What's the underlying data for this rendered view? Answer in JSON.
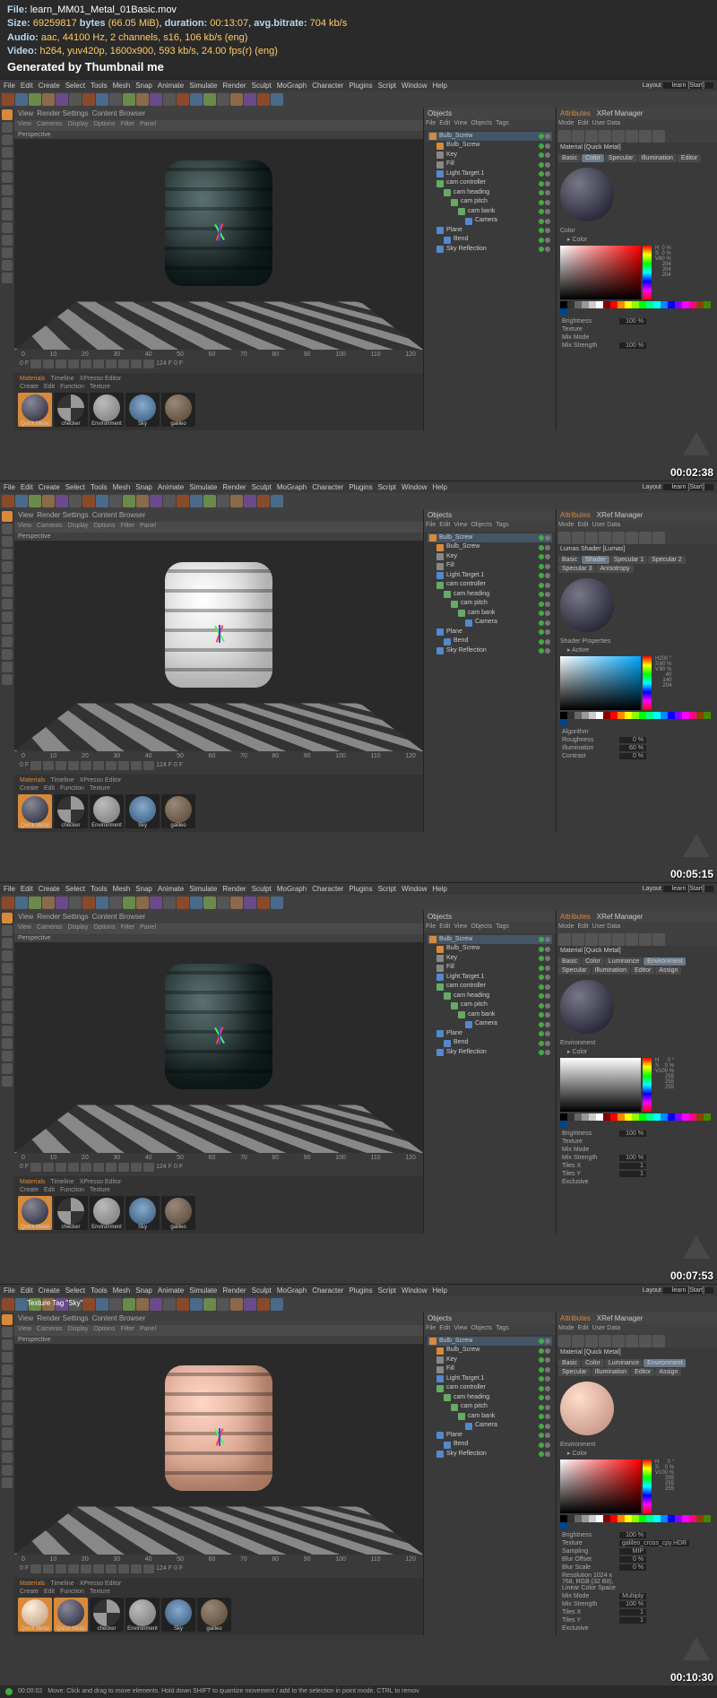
{
  "header": {
    "file_label": "File:",
    "file": "learn_MM01_Metal_01Basic.mov",
    "size_label": "Size:",
    "size_bytes": "69259817",
    "size_unit": "bytes",
    "size_mib": "(66.05 MiB)",
    "duration_label": "duration:",
    "duration": "00:13:07",
    "bitrate_label": "avg.bitrate:",
    "bitrate": "704 kb/s",
    "audio_label": "Audio:",
    "audio": "aac, 44100 Hz, 2 channels, s16, 106 kb/s (eng)",
    "video_label": "Video:",
    "video": "h264, yuv420p, 1600x900, 593 kb/s, 24.00 fps(r) (eng)",
    "generated": "Generated by Thumbnail me"
  },
  "menus": [
    "File",
    "Edit",
    "Create",
    "Select",
    "Tools",
    "Mesh",
    "Snap",
    "Animate",
    "Simulate",
    "Render",
    "Sculpt",
    "MoGraph",
    "Character",
    "Plugins",
    "Script",
    "Window",
    "Help"
  ],
  "layout_label": "Layout",
  "layout_value": "learn [Start]",
  "vp_header": [
    "View",
    "Render Settings",
    "Content Browser"
  ],
  "vp_sub": [
    "View",
    "Cameras",
    "Display",
    "Options",
    "Filter",
    "Panel"
  ],
  "vp_label": "Perspective",
  "timeline_ticks": [
    "0",
    "10",
    "20",
    "30",
    "40",
    "50",
    "60",
    "70",
    "80",
    "90",
    "100",
    "110",
    "120"
  ],
  "timeline_start": "0 F",
  "timeline_end": "124 F",
  "timeline_cur": "0 F",
  "materials_header": [
    "Create",
    "Edit",
    "Function",
    "Texture"
  ],
  "materials_tab1": "Materials",
  "materials_tab2": "Timeline",
  "materials_tab3": "XPresso Editor",
  "mat_names": [
    "Quick Metal",
    "checker",
    "Environment",
    "Sky",
    "galileo"
  ],
  "objects_title": "Objects",
  "objects_tabs": [
    "File",
    "Edit",
    "View",
    "Objects",
    "Tags"
  ],
  "tree": [
    {
      "name": "Bulb_Screw",
      "lvl": 0,
      "ic": "ti-orange",
      "sel": true
    },
    {
      "name": "Bulb_Screw",
      "lvl": 1,
      "ic": "ti-orange"
    },
    {
      "name": "Key",
      "lvl": 1,
      "ic": "ti-gray"
    },
    {
      "name": "Fill",
      "lvl": 1,
      "ic": "ti-gray"
    },
    {
      "name": "Light.Target.1",
      "lvl": 1,
      "ic": "ti-blue"
    },
    {
      "name": "cam controller",
      "lvl": 1,
      "ic": "ti-green"
    },
    {
      "name": "cam heading",
      "lvl": 2,
      "ic": "ti-green"
    },
    {
      "name": "cam pitch",
      "lvl": 3,
      "ic": "ti-green"
    },
    {
      "name": "cam bank",
      "lvl": 4,
      "ic": "ti-green"
    },
    {
      "name": "Camera",
      "lvl": 5,
      "ic": "ti-blue"
    },
    {
      "name": "Plane",
      "lvl": 1,
      "ic": "ti-blue"
    },
    {
      "name": "Bend",
      "lvl": 2,
      "ic": "ti-blue"
    },
    {
      "name": "Sky Reflection",
      "lvl": 1,
      "ic": "ti-blue"
    }
  ],
  "attr_title": "Attributes",
  "attr_tab2": "XRef Manager",
  "attr_sub": [
    "Mode",
    "Edit",
    "User Data"
  ],
  "frames": [
    {
      "ts": "00:02:38",
      "obj": "obj-dark",
      "mat_title": "Material [Quick Metal]",
      "tabs": [
        {
          "l": "Basic"
        },
        {
          "l": "Color",
          "a": true
        },
        {
          "l": "Specular"
        },
        {
          "l": "Illumination"
        },
        {
          "l": "Editor"
        }
      ],
      "sect": "Color",
      "sub": "Color",
      "picker": "red",
      "preview": "",
      "cvals": [
        [
          "H",
          "0 %"
        ],
        [
          "S",
          "0 %"
        ],
        [
          "V",
          "80 %"
        ],
        [
          "",
          "204"
        ],
        [
          "",
          "204"
        ],
        [
          "",
          "204"
        ]
      ],
      "params": [
        [
          "Brightness",
          "100 %"
        ],
        [
          "Texture",
          ""
        ],
        [
          "Mix Mode",
          ""
        ],
        [
          "Mix Strength",
          "100 %"
        ]
      ]
    },
    {
      "ts": "00:05:15",
      "obj": "obj-white",
      "mat_title": "Lumas Shader [Lumas]",
      "tabs": [
        {
          "l": "Basic"
        },
        {
          "l": "Shader",
          "a": true
        },
        {
          "l": "Specular 1"
        },
        {
          "l": "Specular 2"
        },
        {
          "l": "Specular 3"
        },
        {
          "l": "Anisotropy"
        }
      ],
      "sect": "Shader Properties",
      "sub": "Active",
      "picker": "blue",
      "preview": "",
      "cvals": [
        [
          "H",
          "200 °"
        ],
        [
          "S",
          "80 %"
        ],
        [
          "V",
          "80 %"
        ],
        [
          "",
          "40"
        ],
        [
          "",
          "140"
        ],
        [
          "",
          "204"
        ]
      ],
      "params": [
        [
          "Algorithm",
          ""
        ],
        [
          "Roughness",
          "0 %"
        ],
        [
          "Illumination",
          "60 %"
        ],
        [
          "Contrast",
          "0 %"
        ]
      ]
    },
    {
      "ts": "00:07:53",
      "obj": "obj-dark",
      "mat_title": "Material [Quick Metal]",
      "tabs": [
        {
          "l": "Basic"
        },
        {
          "l": "Color"
        },
        {
          "l": "Luminance"
        },
        {
          "l": "Environment",
          "a": true
        },
        {
          "l": "Specular"
        },
        {
          "l": "Illumination"
        },
        {
          "l": "Editor"
        },
        {
          "l": "Assign"
        }
      ],
      "sect": "Environment",
      "sub": "Color",
      "picker": "white",
      "preview": "",
      "cvals": [
        [
          "H",
          "0 °"
        ],
        [
          "S",
          "0 %"
        ],
        [
          "V",
          "100 %"
        ],
        [
          "",
          "255"
        ],
        [
          "",
          "255"
        ],
        [
          "",
          "255"
        ]
      ],
      "params": [
        [
          "Brightness",
          "100 %"
        ],
        [
          "Texture",
          ""
        ],
        [
          "Mix Mode",
          ""
        ],
        [
          "Mix Strength",
          "100 %"
        ],
        [
          "Tiles X",
          "1"
        ],
        [
          "Tiles Y",
          "1"
        ],
        [
          "Exclusive",
          ""
        ]
      ]
    },
    {
      "ts": "00:10:30",
      "obj": "obj-copper",
      "mat_title": "Material [Quick Metal]",
      "tabs": [
        {
          "l": "Basic"
        },
        {
          "l": "Color"
        },
        {
          "l": "Luminance"
        },
        {
          "l": "Environment",
          "a": true
        },
        {
          "l": "Specular"
        },
        {
          "l": "Illumination"
        },
        {
          "l": "Editor"
        },
        {
          "l": "Assign"
        }
      ],
      "sect": "Environment",
      "sub": "Color",
      "picker": "red",
      "preview": "copper",
      "cvals": [
        [
          "H",
          "0 °"
        ],
        [
          "S",
          "0 %"
        ],
        [
          "V",
          "100 %"
        ],
        [
          "",
          "255"
        ],
        [
          "",
          "255"
        ],
        [
          "",
          "255"
        ]
      ],
      "params": [
        [
          "Brightness",
          "100 %"
        ],
        [
          "Texture",
          "galileo_cross_cpy.HDR"
        ],
        [
          "Sampling",
          "MIP"
        ],
        [
          "Blur Offset",
          "0 %"
        ],
        [
          "Blur Scale",
          "0 %"
        ],
        [
          "Resolution 1024 x 768, RGB (32 Bit), Linear Color Space",
          ""
        ],
        [
          "Mix Mode",
          "Multiply"
        ],
        [
          "Mix Strength",
          "100 %"
        ],
        [
          "Tiles X",
          "1"
        ],
        [
          "Tiles Y",
          "1"
        ],
        [
          "Exclusive",
          ""
        ]
      ],
      "title_prefix": "Texture Tag \"Sky\""
    }
  ],
  "status": {
    "time": "00:00:02",
    "hint": "Move: Click and drag to move elements. Hold down SHIFT to quantize movement / add to the selection in point mode, CTRL to remov"
  }
}
